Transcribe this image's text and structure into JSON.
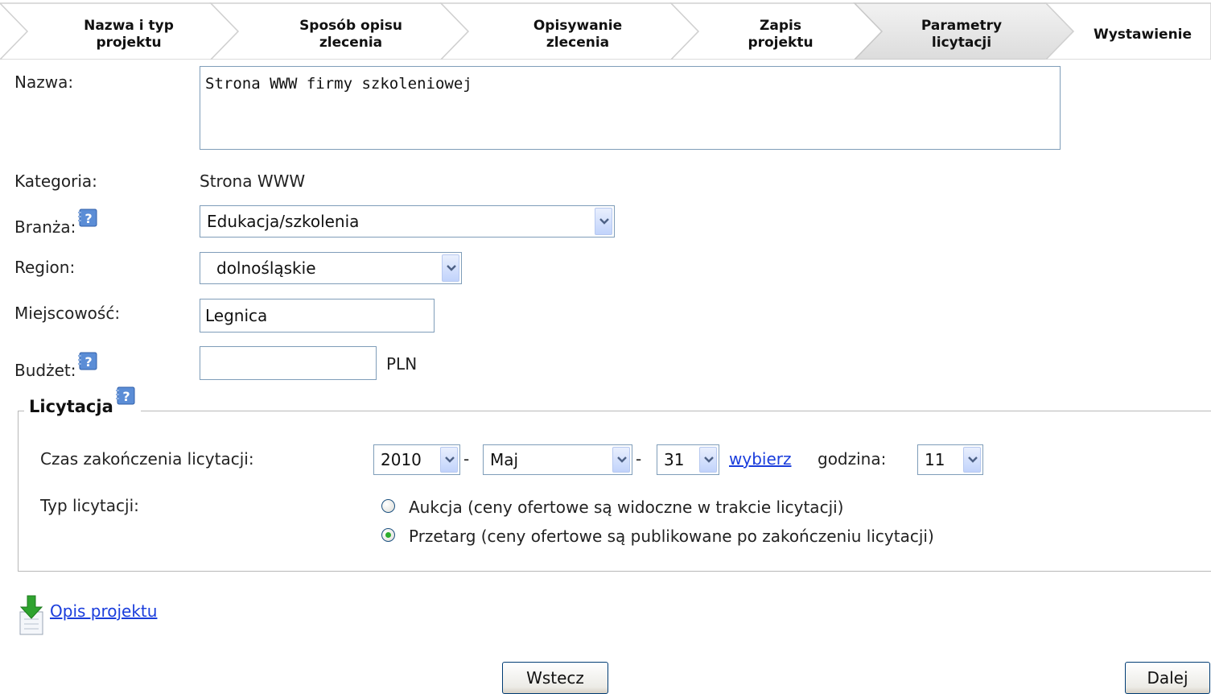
{
  "wizard": {
    "steps": [
      {
        "line1": "Nazwa i typ",
        "line2": "projektu"
      },
      {
        "line1": "Sposób opisu",
        "line2": "zlecenia"
      },
      {
        "line1": "Opisywanie",
        "line2": "zlecenia"
      },
      {
        "line1": "Zapis",
        "line2": "projektu"
      },
      {
        "line1": "Parametry",
        "line2": "licytacji"
      },
      {
        "line1": "Wystawienie",
        "line2": ""
      }
    ],
    "active_step": 5
  },
  "form": {
    "name_label": "Nazwa:",
    "name_value": "Strona WWW firmy szkoleniowej",
    "category_label": "Kategoria:",
    "category_value": "Strona WWW",
    "industry_label": "Branża:",
    "industry_value": "Edukacja/szkolenia",
    "region_label": "Region:",
    "region_value": "dolnośląskie",
    "city_label": "Miejscowość:",
    "city_value": "Legnica",
    "budget_label": "Budżet:",
    "budget_value": "",
    "budget_currency": "PLN"
  },
  "auction": {
    "legend": "Licytacja",
    "end_time_label": "Czas zakończenia licytacji:",
    "year": "2010",
    "month": "Maj",
    "day": "31",
    "separator": "-",
    "choose_link": "wybierz",
    "hour_label": "godzina:",
    "hour": "11",
    "type_label": "Typ licytacji:",
    "options": [
      {
        "label": "Aukcja (ceny ofertowe są widoczne w trakcie licytacji)",
        "selected": false
      },
      {
        "label": "Przetarg (ceny ofertowe są publikowane po zakończeniu licytacji)",
        "selected": true
      }
    ]
  },
  "project_description_link": "Opis projektu",
  "buttons": {
    "back": "Wstecz",
    "next": "Dalej"
  },
  "colors": {
    "active_step_bg": "#e6e6e6",
    "link": "#1a3ddc",
    "radio_selected": "#2bac2b",
    "help_icon": "#5b8dd6"
  }
}
